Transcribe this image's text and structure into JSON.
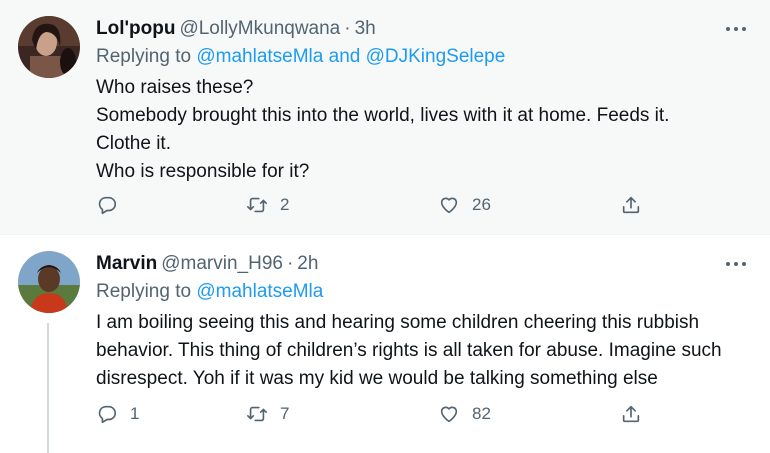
{
  "tweets": [
    {
      "name": "Lol'popu",
      "handle": "@LollyMkunqwana",
      "time": "3h",
      "replying_prefix": "Replying to",
      "mentions": [
        "@mahlatseMla",
        "@DJKingSelepe"
      ],
      "mention_joiner": "and",
      "lines": [
        "Who raises these?",
        "Somebody brought this into the world, lives with it at home. Feeds it.",
        "Clothe it.",
        "Who is responsible for it?"
      ],
      "reply_count": "",
      "retweet_count": "2",
      "like_count": "26",
      "avatar_colors": [
        "#3a2622",
        "#7a5646",
        "#c9a08a"
      ]
    },
    {
      "name": "Marvin",
      "handle": "@marvin_H96",
      "time": "2h",
      "replying_prefix": "Replying to",
      "mentions": [
        "@mahlatseMla"
      ],
      "lines": [
        "I am boiling seeing this and hearing some children cheering this rubbish",
        "behavior. This thing of children’s rights is all taken for abuse. Imagine such",
        "disrespect. Yoh if it was my kid we would be talking something else"
      ],
      "reply_count": "1",
      "retweet_count": "7",
      "like_count": "82",
      "avatar_colors": [
        "#7fa6c9",
        "#5b7a3e",
        "#c8391c"
      ]
    }
  ],
  "icons": {
    "reply": "reply-icon",
    "retweet": "retweet-icon",
    "like": "heart-icon",
    "share": "share-icon",
    "more": "more-icon"
  },
  "colors": {
    "link": "#1d9bf0",
    "secondary_text": "#536471",
    "highlight_bg": "#f7f9f9"
  }
}
